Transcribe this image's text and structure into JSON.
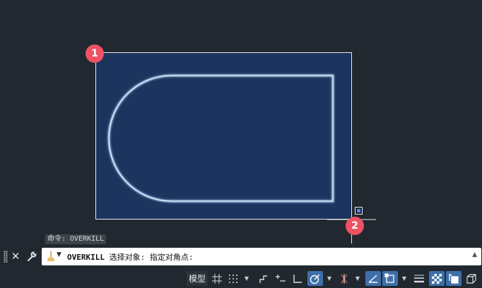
{
  "markers": {
    "first": "1",
    "second": "2"
  },
  "command": {
    "history": "命令: OVERKILL",
    "name": "OVERKILL",
    "prompt": " 选择对象: 指定对角点:"
  },
  "statusbar": {
    "model_label": "模型"
  },
  "icons": {
    "close": "close-icon",
    "customize": "wrench-icon",
    "command_prompt": "broom-icon"
  },
  "colors": {
    "canvas_bg": "#212830",
    "selection_fill": "#1b355e",
    "marker": "#ee5264",
    "active_toggle": "#3e6fa8"
  }
}
